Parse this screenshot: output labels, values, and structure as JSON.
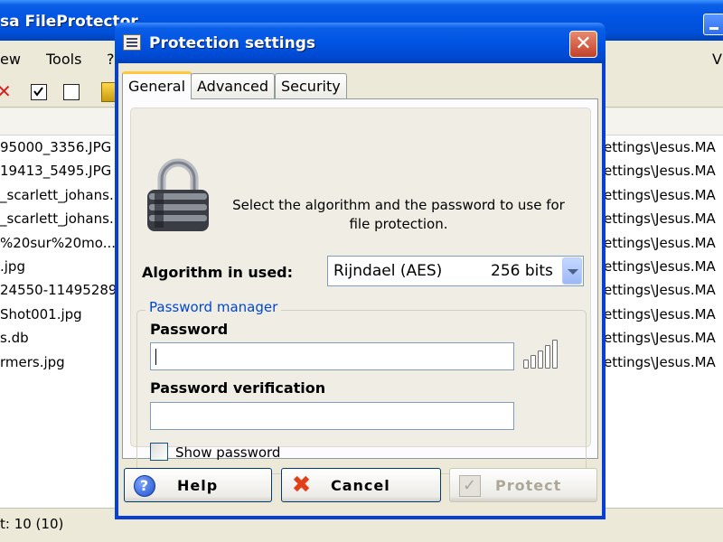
{
  "main_window": {
    "title": "sa FileProtector",
    "menu": [
      "ew",
      "Tools",
      "?"
    ],
    "menu_right": "V",
    "files": [
      {
        "name": "95000_3356.JPG",
        "path": "ettings\\Jesus.MA"
      },
      {
        "name": "19413_5495.JPG",
        "path": "ettings\\Jesus.MA"
      },
      {
        "name": "_scarlett_johans...",
        "path": "ettings\\Jesus.MA"
      },
      {
        "name": "_scarlett_johans...",
        "path": "ettings\\Jesus.MA"
      },
      {
        "name": "%20sur%20mo...",
        "path": "ettings\\Jesus.MA"
      },
      {
        "name": ".jpg",
        "path": "ettings\\Jesus.MA"
      },
      {
        "name": "24550-11495289...",
        "path": "ettings\\Jesus.MA"
      },
      {
        "name": "Shot001.jpg",
        "path": "ettings\\Jesus.MA"
      },
      {
        "name": "s.db",
        "path": "ettings\\Jesus.MA"
      },
      {
        "name": "rmers.jpg",
        "path": "ettings\\Jesus.MA"
      }
    ],
    "status": "t: 10 (10)"
  },
  "dialog": {
    "title": "Protection settings",
    "close_glyph": "✕",
    "tabs": [
      {
        "label": "General",
        "active": true
      },
      {
        "label": "Advanced",
        "active": false
      },
      {
        "label": "Security",
        "active": false
      }
    ],
    "intro_line1": "Select the algorithm and the password to use for",
    "intro_line2": "file protection.",
    "algorithm_label": "Algorithm in used:",
    "algorithm_name": "Rijndael (AES)",
    "algorithm_bits": "256 bits",
    "password_manager_legend": "Password manager",
    "password_label": "Password",
    "password_value": "",
    "verification_label": "Password verification",
    "verification_value": "",
    "show_password_label": "Show password",
    "show_password_checked": false,
    "buttons": {
      "help": "Help",
      "cancel": "Cancel",
      "protect": "Protect"
    }
  },
  "icons": {
    "close": "close-icon",
    "lock": "padlock-icon",
    "help": "help-icon",
    "cancel": "cancel-icon",
    "protect": "checkmark-icon",
    "strength": "signal-strength-icon"
  },
  "colors": {
    "titlebar_blue": "#0054e3",
    "legend_blue": "#0046d5",
    "active_tab_accent": "#ffc83c",
    "close_red": "#c2402a"
  }
}
